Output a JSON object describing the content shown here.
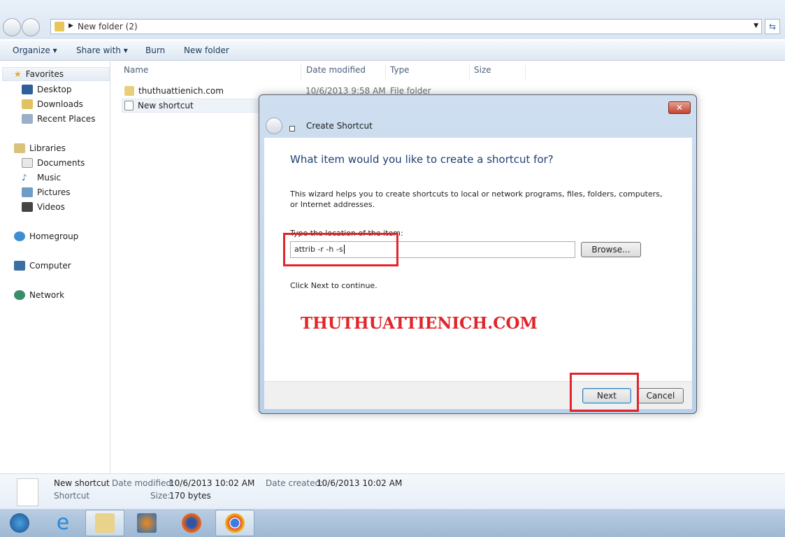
{
  "explorer": {
    "address": "New folder (2)",
    "toolbar": {
      "organize": "Organize ▾",
      "share_with": "Share with ▾",
      "burn": "Burn",
      "new_folder": "New folder"
    },
    "sidebar": {
      "favorites": "Favorites",
      "desktop": "Desktop",
      "downloads": "Downloads",
      "recent": "Recent Places",
      "libraries": "Libraries",
      "documents": "Documents",
      "music": "Music",
      "pictures": "Pictures",
      "videos": "Videos",
      "homegroup": "Homegroup",
      "computer": "Computer",
      "network": "Network"
    },
    "columns": [
      "Name",
      "Date modified",
      "Type",
      "Size"
    ],
    "files": [
      {
        "name": "thuthuattienich.com",
        "date": "10/6/2013 9:58 AM",
        "type": "File folder"
      },
      {
        "name": "New shortcut"
      }
    ],
    "details": {
      "name": "New shortcut",
      "type": "Shortcut",
      "date_modified_label": "Date modified:",
      "date_modified": "10/6/2013 10:02 AM",
      "date_created_label": "Date created:",
      "date_created": "10/6/2013 10:02 AM",
      "size_label": "Size:",
      "size": "170 bytes"
    }
  },
  "dialog": {
    "title": "Create Shortcut",
    "heading": "What item would you like to create a shortcut for?",
    "description": "This wizard helps you to create shortcuts to local or network programs, files, folders, computers, or Internet addresses.",
    "field_label": "Type the location of the item:",
    "field_value": "attrib -r -h -s",
    "browse": "Browse...",
    "hint": "Click Next to continue.",
    "next": "Next",
    "cancel": "Cancel"
  },
  "watermark": "THUTHUATTIENICH.COM",
  "colors": {
    "highlight": "#e0262c",
    "watermark": "#e0262c"
  },
  "taskbar": [
    "start-orb",
    "internet-explorer",
    "windows-explorer",
    "media-player",
    "firefox",
    "chrome"
  ]
}
